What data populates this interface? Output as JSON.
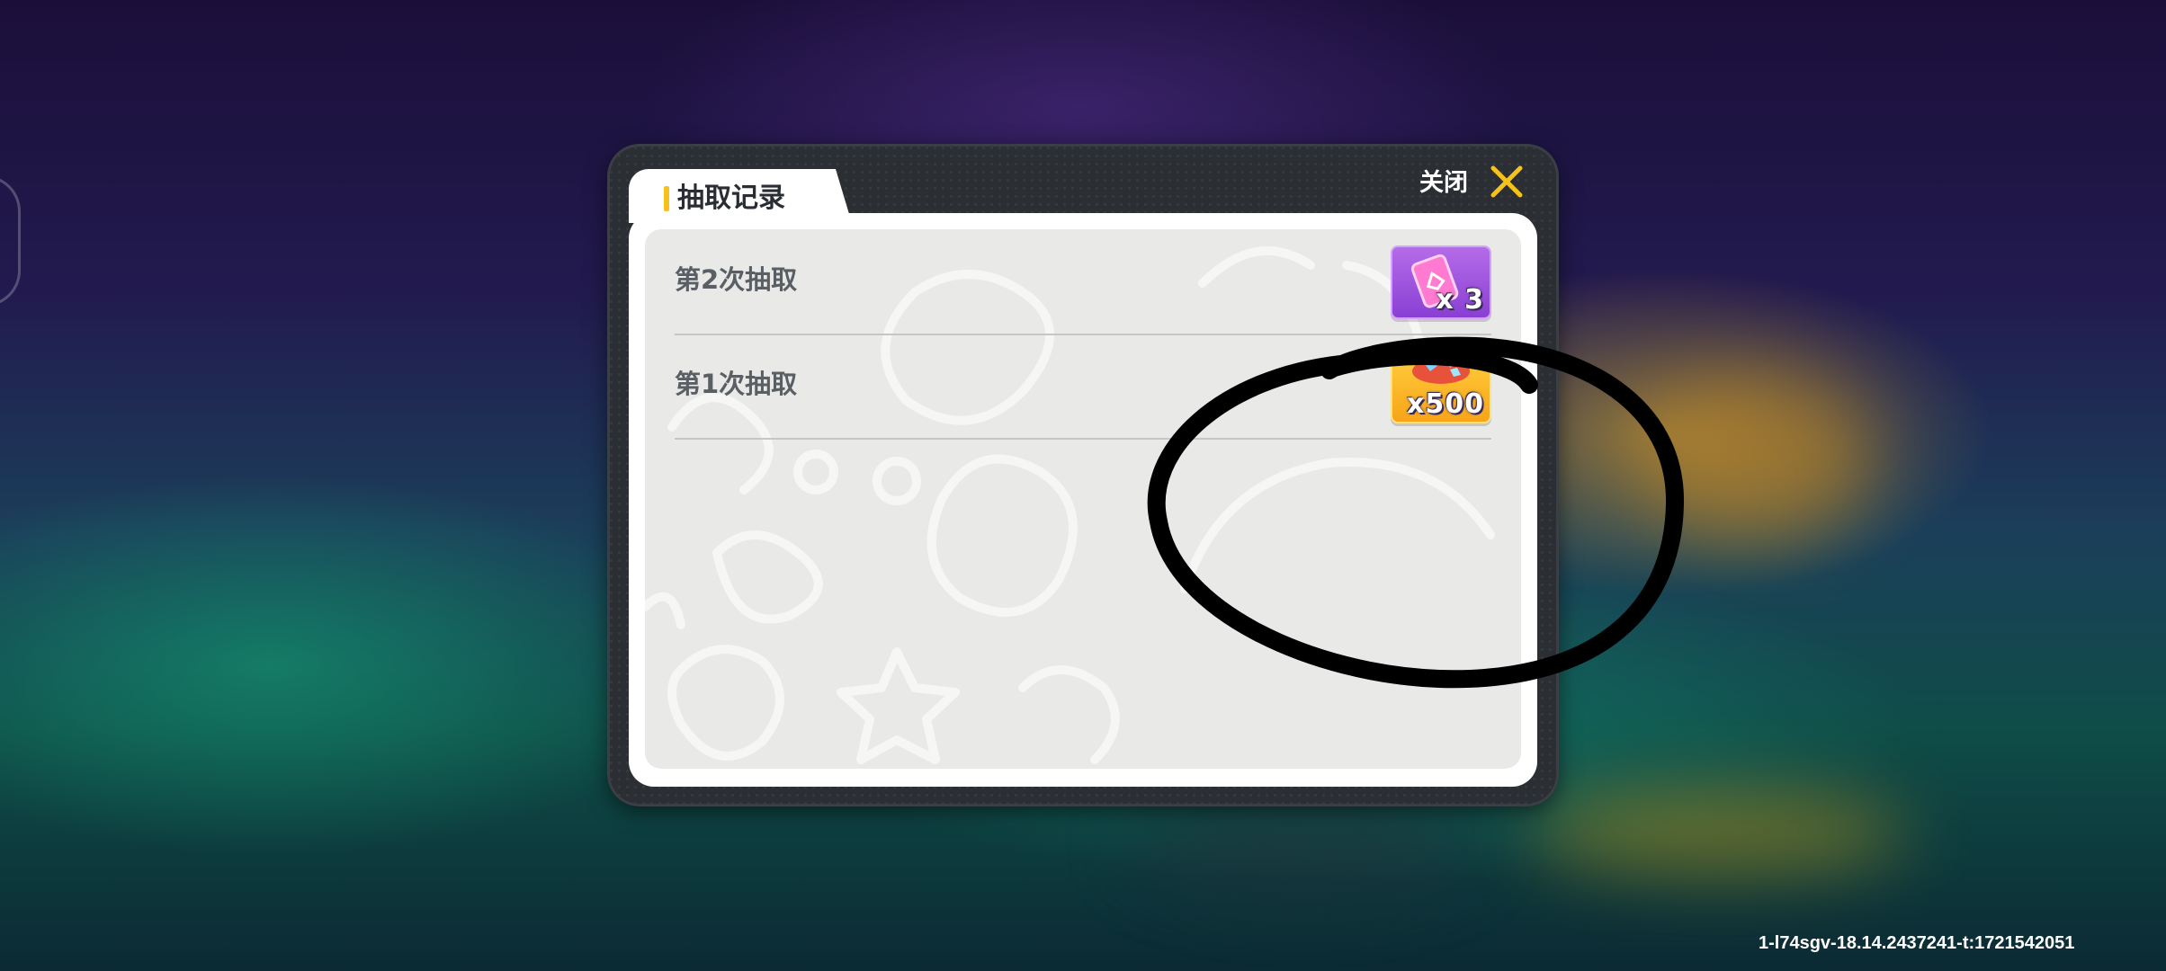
{
  "dialog": {
    "title": "抽取记录",
    "close_label": "关闭",
    "records": [
      {
        "label": "第2次抽取",
        "reward_qty": "x 3",
        "reward_icon": "pink-card-icon",
        "reward_color": "#9b4fe0"
      },
      {
        "label": "第1次抽取",
        "reward_qty": "x500",
        "reward_icon": "gems-icon",
        "reward_color": "#f7b32b"
      }
    ]
  },
  "footer": {
    "id_text": "1-l74sgv-18.14.2437241-t:1721542051"
  },
  "colors": {
    "accent": "#f5c21b",
    "dialog_frame": "#2b2f34"
  }
}
